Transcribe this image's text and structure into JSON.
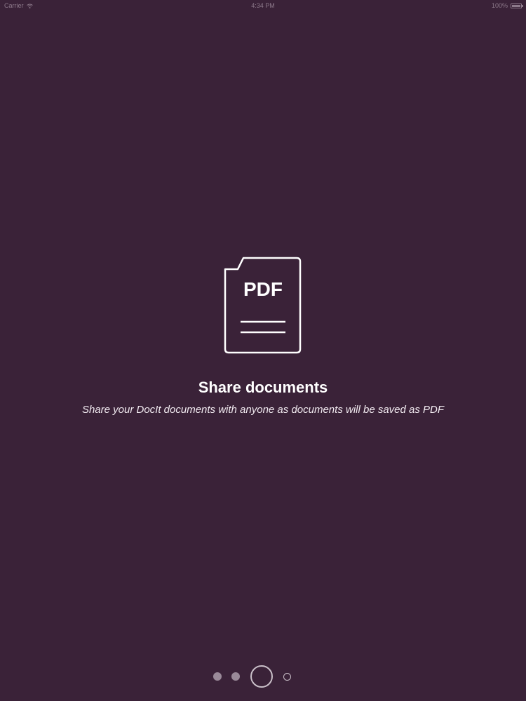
{
  "status_bar": {
    "carrier": "Carrier",
    "time": "4:34 PM",
    "battery": "100%",
    "icons": [
      "wifi-icon",
      "battery-icon"
    ]
  },
  "onboarding": {
    "icon": "pdf-document-icon",
    "icon_text": "PDF",
    "title": "Share documents",
    "subtitle": "Share your DocIt documents with anyone as documents will be saved as PDF"
  },
  "pager": {
    "total_pages": 4,
    "current_page": 3
  },
  "colors": {
    "background": "#3a2238",
    "text": "#ffffff",
    "dot_inactive": "#9a8a99",
    "dot_outline": "#c9bfc8"
  }
}
